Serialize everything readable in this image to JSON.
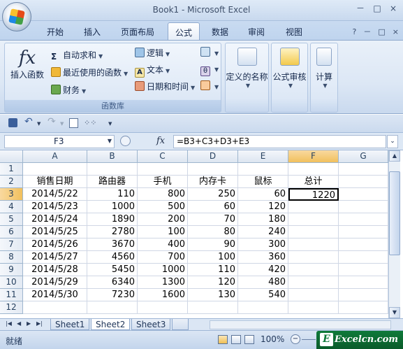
{
  "window": {
    "title": "Book1 - Microsoft Excel",
    "controls": [
      "－",
      "□",
      "×"
    ]
  },
  "tabs": [
    "开始",
    "插入",
    "页面布局",
    "公式",
    "数据",
    "审阅",
    "视图"
  ],
  "active_tab": "公式",
  "ribbon": {
    "insert_function": "插入函数",
    "autosum": "自动求和",
    "recent": "最近使用的函数",
    "financial": "财务",
    "logical": "逻辑",
    "text": "文本",
    "datetime": "日期和时间",
    "defined_names": "定义的名称",
    "formula_auditing": "公式审核",
    "calculation": "计算",
    "group_label": "函数库"
  },
  "formula_bar": {
    "name_box": "F3",
    "fx": "fx",
    "formula": "=B3+C3+D3+E3"
  },
  "columns": [
    "A",
    "B",
    "C",
    "D",
    "E",
    "F",
    "G"
  ],
  "rows": [
    "1",
    "2",
    "3",
    "4",
    "5",
    "6",
    "7",
    "8",
    "9",
    "10",
    "11",
    "12"
  ],
  "headers": [
    "销售日期",
    "路由器",
    "手机",
    "内存卡",
    "鼠标",
    "总计"
  ],
  "data": [
    [
      "2014/5/22",
      "110",
      "800",
      "250",
      "60",
      "1220"
    ],
    [
      "2014/5/23",
      "1000",
      "500",
      "60",
      "120",
      ""
    ],
    [
      "2014/5/24",
      "1890",
      "200",
      "70",
      "180",
      ""
    ],
    [
      "2014/5/25",
      "2780",
      "100",
      "80",
      "240",
      ""
    ],
    [
      "2014/5/26",
      "3670",
      "400",
      "90",
      "300",
      ""
    ],
    [
      "2014/5/27",
      "4560",
      "700",
      "100",
      "360",
      ""
    ],
    [
      "2014/5/28",
      "5450",
      "1000",
      "110",
      "420",
      ""
    ],
    [
      "2014/5/29",
      "6340",
      "1300",
      "120",
      "480",
      ""
    ],
    [
      "2014/5/30",
      "7230",
      "1600",
      "130",
      "540",
      ""
    ]
  ],
  "active_cell": "F3",
  "sheets": [
    "Sheet1",
    "Sheet2",
    "Sheet3"
  ],
  "active_sheet": "Sheet2",
  "status": {
    "ready": "就绪",
    "zoom": "100%"
  },
  "watermark": {
    "brand_text": "Excelcn.com",
    "letter": "E"
  }
}
